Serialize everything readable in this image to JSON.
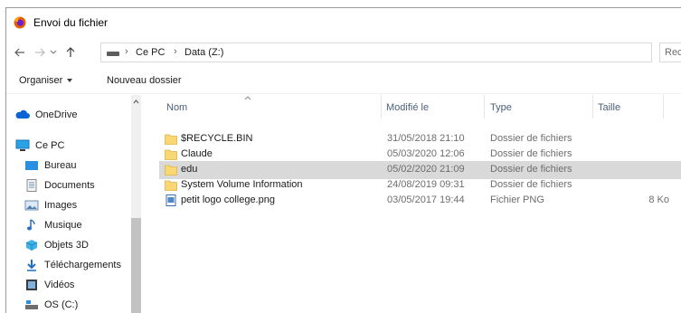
{
  "window": {
    "title": "Envoi du fichier"
  },
  "address": {
    "crumbs": [
      "Ce PC",
      "Data (Z:)"
    ],
    "search_placeholder": "Reche"
  },
  "toolbar": {
    "organise_label": "Organiser",
    "new_folder_label": "Nouveau dossier"
  },
  "sidebar": {
    "items": [
      {
        "label": "OneDrive",
        "icon": "cloud-icon"
      },
      {
        "label": "Ce PC",
        "icon": "computer-icon"
      },
      {
        "label": "Bureau",
        "icon": "desktop-icon"
      },
      {
        "label": "Documents",
        "icon": "documents-icon"
      },
      {
        "label": "Images",
        "icon": "images-icon"
      },
      {
        "label": "Musique",
        "icon": "music-icon"
      },
      {
        "label": "Objets 3D",
        "icon": "3d-objects-icon"
      },
      {
        "label": "Téléchargements",
        "icon": "downloads-icon"
      },
      {
        "label": "Vidéos",
        "icon": "videos-icon"
      },
      {
        "label": "OS (C:)",
        "icon": "drive-icon"
      }
    ]
  },
  "columns": {
    "name": "Nom",
    "modified": "Modifié le",
    "type": "Type",
    "size": "Taille"
  },
  "files": [
    {
      "name": "$RECYCLE.BIN",
      "modified": "31/05/2018 21:10",
      "type": "Dossier de fichiers",
      "size": "",
      "icon": "folder-icon",
      "selected": false
    },
    {
      "name": "Claude",
      "modified": "05/03/2020 12:06",
      "type": "Dossier de fichiers",
      "size": "",
      "icon": "folder-icon",
      "selected": false
    },
    {
      "name": "edu",
      "modified": "05/02/2020 21:09",
      "type": "Dossier de fichiers",
      "size": "",
      "icon": "folder-icon",
      "selected": true
    },
    {
      "name": "System Volume Information",
      "modified": "24/08/2019 09:31",
      "type": "Dossier de fichiers",
      "size": "",
      "icon": "folder-icon",
      "selected": false
    },
    {
      "name": "petit logo college.png",
      "modified": "03/05/2017 19:44",
      "type": "Fichier PNG",
      "size": "8 Ko",
      "icon": "png-file-icon",
      "selected": false
    }
  ],
  "colors": {
    "accent": "#0078d7",
    "folder": "#f8d775",
    "selected_row": "#d9d9d9",
    "header_text": "#4c607a"
  }
}
